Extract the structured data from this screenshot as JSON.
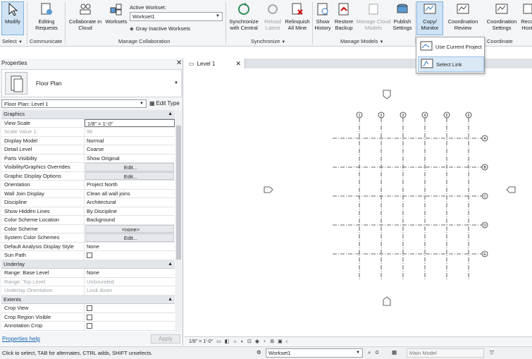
{
  "ribbon": {
    "modify": {
      "label": "Modify",
      "group": "Select"
    },
    "editing_requests": "Editing Requests",
    "communicate": "Communicate",
    "collaborate_in_cloud": "Collaborate in Cloud",
    "worksets": "Worksets",
    "active_workset_label": "Active Workset:",
    "active_workset_value": "Workset1",
    "gray_inactive": "Gray Inactive Worksets",
    "manage_collaboration": "Manage Collaboration",
    "sync_central": "Synchronize with Central",
    "reload_latest": "Reload Latest",
    "relinquish_all": "Relinquish All Mine",
    "synchronize": "Synchronize",
    "show_history": "Show History",
    "restore_backup": "Restore Backup",
    "manage_cloud": "Manage Cloud Models",
    "publish_settings": "Publish Settings",
    "manage_models": "Manage Models",
    "copy_monitor": "Copy/ Monitor",
    "coord_review": "Coordination Review",
    "coord_settings": "Coordination Settings",
    "reconcile_hosting": "Reco Host",
    "coordinate": "Coordinate"
  },
  "dropdown": {
    "items": [
      "Use Current Project",
      "Select Link"
    ]
  },
  "properties": {
    "title": "Properties",
    "type_name": "Floor Plan",
    "instance_select": "Floor Plan: Level 1",
    "edit_type": "Edit Type",
    "sections": [
      {
        "name": "Graphics",
        "rows": [
          {
            "k": "View Scale",
            "v": "1/8\" = 1'-0\""
          },
          {
            "k": "Scale Value   1:",
            "v": "96"
          },
          {
            "k": "Display Model",
            "v": "Normal"
          },
          {
            "k": "Detail Level",
            "v": "Coarse"
          },
          {
            "k": "Parts Visibility",
            "v": "Show Original"
          },
          {
            "k": "Visibility/Graphics Overrides",
            "v": "Edit..."
          },
          {
            "k": "Graphic Display Options",
            "v": "Edit..."
          },
          {
            "k": "Orientation",
            "v": "Project North"
          },
          {
            "k": "Wall Join Display",
            "v": "Clean all wall joins"
          },
          {
            "k": "Discipline",
            "v": "Architectural"
          },
          {
            "k": "Show Hidden Lines",
            "v": "By Discipline"
          },
          {
            "k": "Color Scheme Location",
            "v": "Background"
          },
          {
            "k": "Color Scheme",
            "v": "<none>"
          },
          {
            "k": "System Color Schemes",
            "v": "Edit..."
          },
          {
            "k": "Default Analysis Display Style",
            "v": "None"
          },
          {
            "k": "Sun Path",
            "v": ""
          }
        ]
      },
      {
        "name": "Underlay",
        "rows": [
          {
            "k": "Range: Base Level",
            "v": "None"
          },
          {
            "k": "Range: Top Level",
            "v": "Unbounded"
          },
          {
            "k": "Underlay Orientation",
            "v": "Look down"
          }
        ]
      },
      {
        "name": "Extents",
        "rows": [
          {
            "k": "Crop View",
            "v": ""
          },
          {
            "k": "Crop Region Visible",
            "v": ""
          },
          {
            "k": "Annotation Crop",
            "v": ""
          }
        ]
      }
    ],
    "help_link": "Properties help",
    "apply": "Apply"
  },
  "view": {
    "tab_label": "Level 1",
    "grid_cols": [
      "1",
      "2",
      "3",
      "4",
      "5",
      "6"
    ],
    "grid_rows": [
      "A",
      "B",
      "C",
      "D",
      "E"
    ],
    "scale_text": "1/8\" = 1'-0\""
  },
  "status": {
    "message": "Click to select, TAB for alternates, CTRL adds, SHIFT unselects.",
    "workset": "Workset1",
    "editable_count": "0",
    "main_model": "Main Model"
  }
}
